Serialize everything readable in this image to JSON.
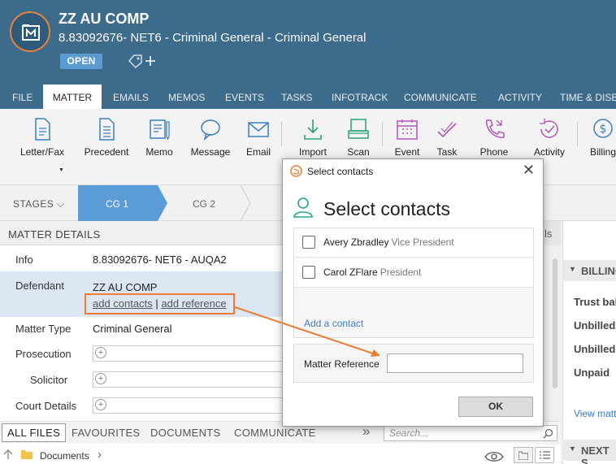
{
  "header": {
    "title": "ZZ AU COMP",
    "subtitle": "8.83092676- NET6 - Criminal General - Criminal General",
    "status_badge": "OPEN",
    "accent_color": "#e8833a",
    "brand_color": "#3c6b8c"
  },
  "tabs": [
    "FILE",
    "MATTER",
    "EMAILS",
    "MEMOS",
    "EVENTS",
    "TASKS",
    "INFOTRACK",
    "COMMUNICATE",
    "ACTIVITY",
    "TIME & DISB"
  ],
  "active_tab": "MATTER",
  "ribbon": [
    {
      "label": "Letter/Fax",
      "icon": "letter-icon"
    },
    {
      "label": "Precedent",
      "icon": "precedent-icon"
    },
    {
      "label": "Memo",
      "icon": "memo-icon"
    },
    {
      "label": "Message",
      "icon": "message-icon"
    },
    {
      "label": "Email",
      "icon": "email-icon"
    },
    {
      "label": "Import",
      "icon": "import-icon"
    },
    {
      "label": "Scan",
      "icon": "scan-icon"
    },
    {
      "label": "Event",
      "icon": "calendar-icon"
    },
    {
      "label": "Task",
      "icon": "task-icon"
    },
    {
      "label": "Phone",
      "icon": "phone-icon"
    },
    {
      "label": "Activity",
      "icon": "activity-icon"
    },
    {
      "label": "Billing",
      "icon": "billing-icon"
    }
  ],
  "stages": {
    "label": "STAGES",
    "items": [
      "CG 1",
      "CG 2"
    ],
    "active": "CG 1"
  },
  "matter_details": {
    "heading": "MATTER DETAILS",
    "info": {
      "label": "Info",
      "value": "8.83092676- NET6 - AUQA2"
    },
    "defendant": {
      "label": "Defendant",
      "value": "ZZ AU COMP",
      "add_contacts": "add contacts",
      "separator": "|",
      "add_reference": "add reference"
    },
    "matter_type": {
      "label": "Matter Type",
      "value": "Criminal General"
    },
    "prosecution": {
      "label": "Prosecution"
    },
    "solicitor": {
      "label": "Solicitor"
    },
    "court_details": {
      "label": "Court Details"
    }
  },
  "right_panel": {
    "tab_fragment": "ls",
    "billing_heading": "BILLING",
    "items": [
      "Trust bal",
      "Unbilled",
      "Unbilled",
      "Unpaid"
    ],
    "view_link": "View matt",
    "next_heading": "NEXT S"
  },
  "bottom_tabs": [
    "ALL FILES",
    "FAVOURITES",
    "DOCUMENTS",
    "COMMUNICATE"
  ],
  "search": {
    "placeholder": "Search..."
  },
  "breadcrumb": {
    "folder": "Documents"
  },
  "dialog": {
    "window_title": "Select contacts",
    "heading": "Select contacts",
    "contacts": [
      {
        "name": "Avery Zbradley",
        "role": "Vice President",
        "checked": false
      },
      {
        "name": "Carol ZFlare",
        "role": "President",
        "checked": false
      }
    ],
    "add_contact": "Add a contact",
    "reference_label": "Matter Reference",
    "reference_value": "",
    "ok_label": "OK"
  }
}
